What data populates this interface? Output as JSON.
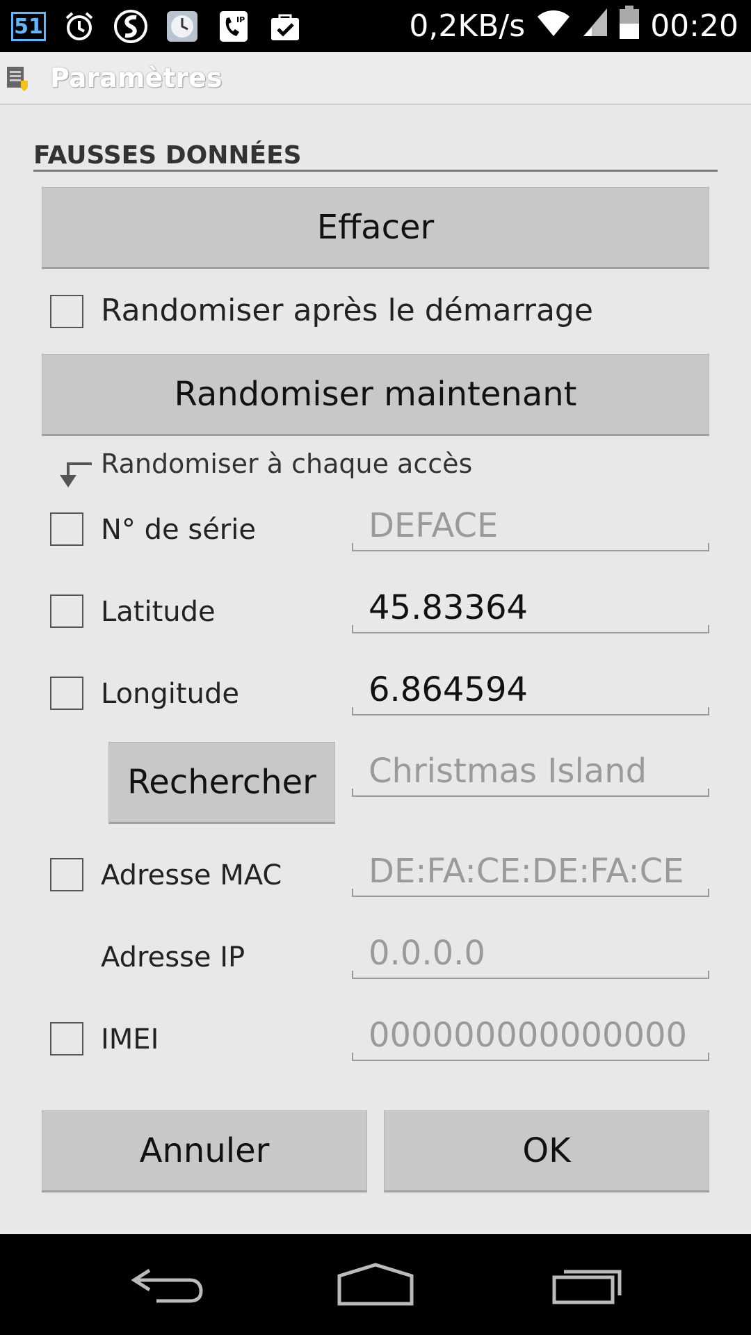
{
  "status_bar": {
    "notification_count": "51",
    "data_rate": "0,2KB/s",
    "time": "00:20",
    "icons": [
      "alarm-icon",
      "app-s-icon",
      "clock-app-icon",
      "sip-phone-icon",
      "shopping-bag-check-icon",
      "wifi-icon",
      "signal-icon",
      "battery-icon"
    ]
  },
  "title_bar": {
    "title": "Paramètres",
    "icon": "settings-app-icon"
  },
  "section": {
    "header": "FAUSSES DONNÉES"
  },
  "buttons": {
    "clear": "Effacer",
    "randomize_now": "Randomiser maintenant",
    "search": "Rechercher",
    "cancel": "Annuler",
    "ok": "OK"
  },
  "options": {
    "randomize_after_boot": "Randomiser après le démarrage",
    "randomize_each_access": "Randomiser à chaque accès"
  },
  "fields": {
    "serial": {
      "label": "N° de série",
      "placeholder": "DEFACE"
    },
    "latitude": {
      "label": "Latitude",
      "value": "45.83364"
    },
    "longitude": {
      "label": "Longitude",
      "value": "6.864594"
    },
    "location_search": {
      "placeholder": "Christmas Island"
    },
    "mac": {
      "label": "Adresse MAC",
      "placeholder": "DE:FA:CE:DE:FA:CE"
    },
    "ip": {
      "label": "Adresse IP",
      "placeholder": "0.0.0.0"
    },
    "imei": {
      "label": "IMEI",
      "placeholder": "000000000000000"
    }
  },
  "colors": {
    "background": "#e8e8e8",
    "button": "#c8c8c8",
    "accent_badge": "#5fb8ff"
  }
}
